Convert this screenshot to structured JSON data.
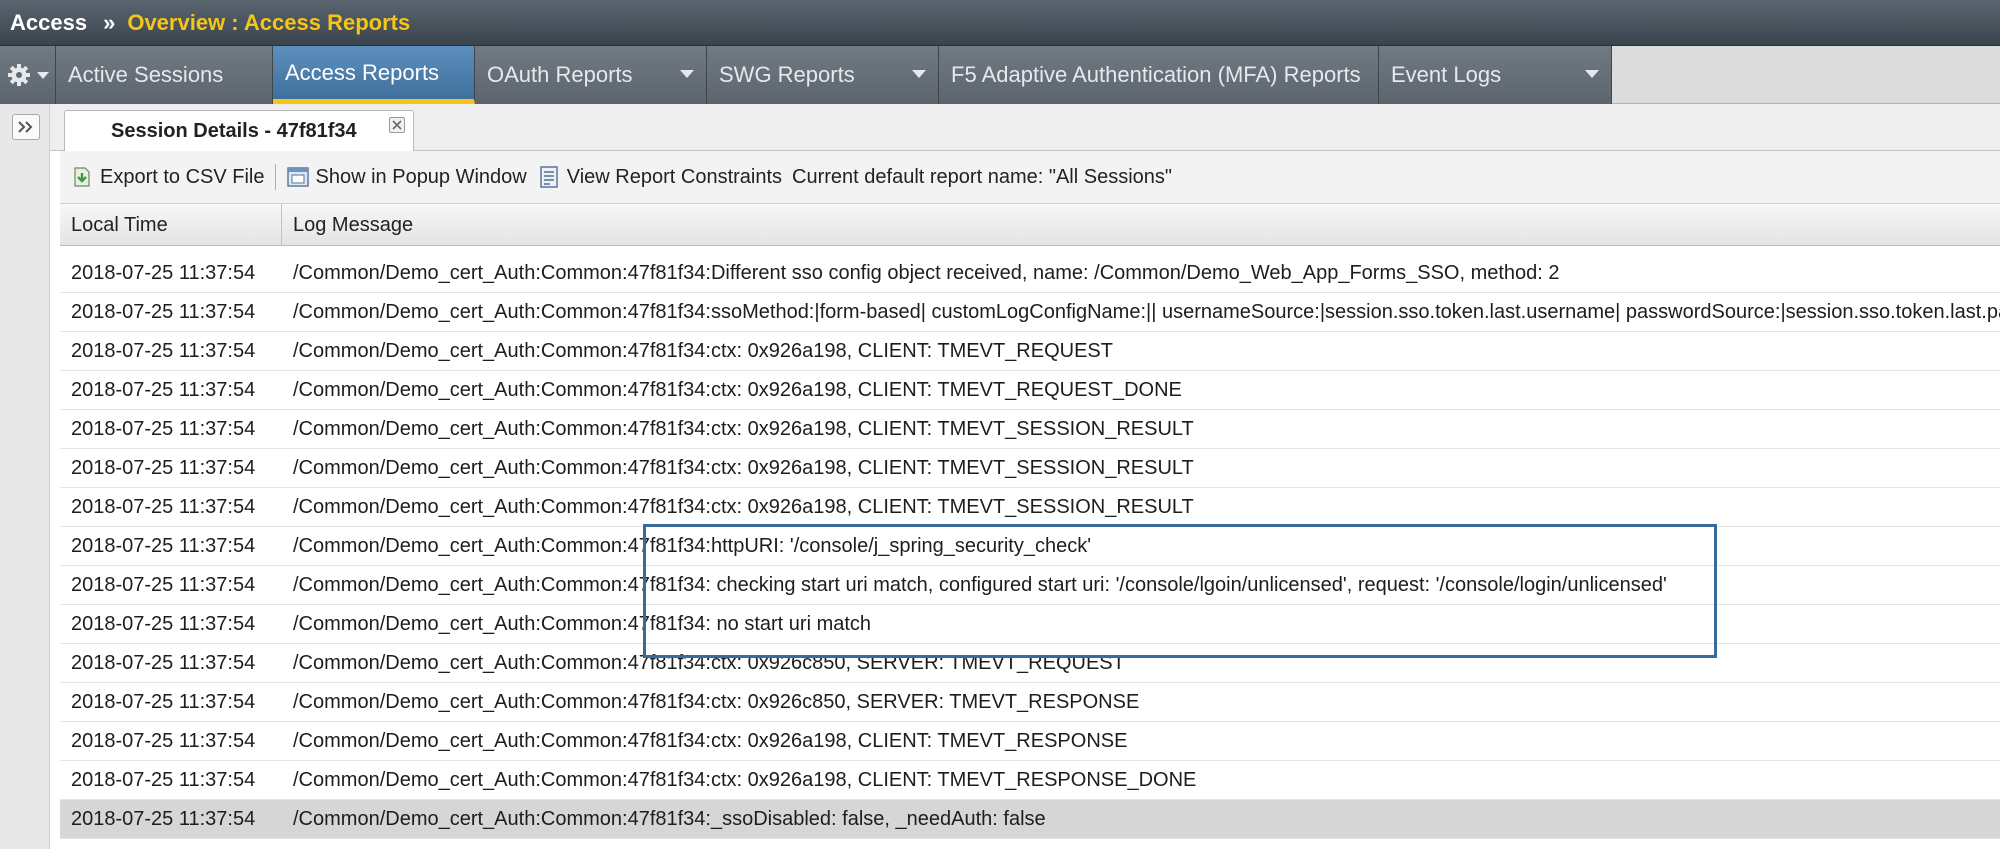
{
  "breadcrumb": {
    "root": "Access",
    "separator": "»",
    "current": "Overview : Access Reports"
  },
  "menu": {
    "tabs": [
      {
        "label": "Active Sessions"
      },
      {
        "label": "Access Reports",
        "active": true
      },
      {
        "label": "OAuth Reports",
        "dropdown": true
      },
      {
        "label": "SWG Reports",
        "dropdown": true
      },
      {
        "label": "F5 Adaptive Authentication (MFA) Reports"
      },
      {
        "label": "Event Logs",
        "dropdown": true
      }
    ]
  },
  "doc_tab": {
    "title": "Session Details - 47f81f34"
  },
  "toolbar": {
    "export_label": "Export to CSV File",
    "popup_label": "Show in Popup Window",
    "constraints_label": "View Report Constraints",
    "current_report": "Current default report name: \"All Sessions\""
  },
  "grid": {
    "columns": {
      "time": "Local Time",
      "message": "Log Message"
    },
    "rows": [
      {
        "time": "2018-07-25 11:37:54",
        "message": "/Common/Demo_cert_Auth:Common:47f81f34:Different sso config object received, name: /Common/Demo_Web_App_Forms_SSO, method: 2"
      },
      {
        "time": "2018-07-25 11:37:54",
        "message": "/Common/Demo_cert_Auth:Common:47f81f34:ssoMethod:|form-based| customLogConfigName:|| usernameSource:|session.sso.token.last.username| passwordSource:|session.sso.token.last.password|"
      },
      {
        "time": "2018-07-25 11:37:54",
        "message": "/Common/Demo_cert_Auth:Common:47f81f34:ctx: 0x926a198, CLIENT: TMEVT_REQUEST"
      },
      {
        "time": "2018-07-25 11:37:54",
        "message": "/Common/Demo_cert_Auth:Common:47f81f34:ctx: 0x926a198, CLIENT: TMEVT_REQUEST_DONE"
      },
      {
        "time": "2018-07-25 11:37:54",
        "message": "/Common/Demo_cert_Auth:Common:47f81f34:ctx: 0x926a198, CLIENT: TMEVT_SESSION_RESULT"
      },
      {
        "time": "2018-07-25 11:37:54",
        "message": "/Common/Demo_cert_Auth:Common:47f81f34:ctx: 0x926a198, CLIENT: TMEVT_SESSION_RESULT"
      },
      {
        "time": "2018-07-25 11:37:54",
        "message": "/Common/Demo_cert_Auth:Common:47f81f34:ctx: 0x926a198, CLIENT: TMEVT_SESSION_RESULT"
      },
      {
        "time": "2018-07-25 11:37:54",
        "message": "/Common/Demo_cert_Auth:Common:47f81f34:httpURI: '/console/j_spring_security_check'"
      },
      {
        "time": "2018-07-25 11:37:54",
        "message": "/Common/Demo_cert_Auth:Common:47f81f34: checking start uri match, configured start uri: '/console/lgoin/unlicensed', request: '/console/login/unlicensed'"
      },
      {
        "time": "2018-07-25 11:37:54",
        "message": "/Common/Demo_cert_Auth:Common:47f81f34: no start uri match"
      },
      {
        "time": "2018-07-25 11:37:54",
        "message": "/Common/Demo_cert_Auth:Common:47f81f34:ctx: 0x926c850, SERVER: TMEVT_REQUEST"
      },
      {
        "time": "2018-07-25 11:37:54",
        "message": "/Common/Demo_cert_Auth:Common:47f81f34:ctx: 0x926c850, SERVER: TMEVT_RESPONSE"
      },
      {
        "time": "2018-07-25 11:37:54",
        "message": "/Common/Demo_cert_Auth:Common:47f81f34:ctx: 0x926a198, CLIENT: TMEVT_RESPONSE"
      },
      {
        "time": "2018-07-25 11:37:54",
        "message": "/Common/Demo_cert_Auth:Common:47f81f34:ctx: 0x926a198, CLIENT: TMEVT_RESPONSE_DONE"
      },
      {
        "time": "2018-07-25 11:37:54",
        "message": "/Common/Demo_cert_Auth:Common:47f81f34:_ssoDisabled: false, _needAuth: false",
        "selected": true
      }
    ]
  },
  "icons": {
    "settings": "gear-icon",
    "expand": "double-chevron-right-icon",
    "close": "close-icon",
    "export": "csv-export-icon",
    "popup": "popup-window-icon",
    "constraints": "report-constraints-icon"
  },
  "colors": {
    "active_tab": "#4a7fb0",
    "active_tab_underline": "#f5c518",
    "breadcrumb_current": "#f5c518",
    "highlight_border": "#3a6a98"
  }
}
